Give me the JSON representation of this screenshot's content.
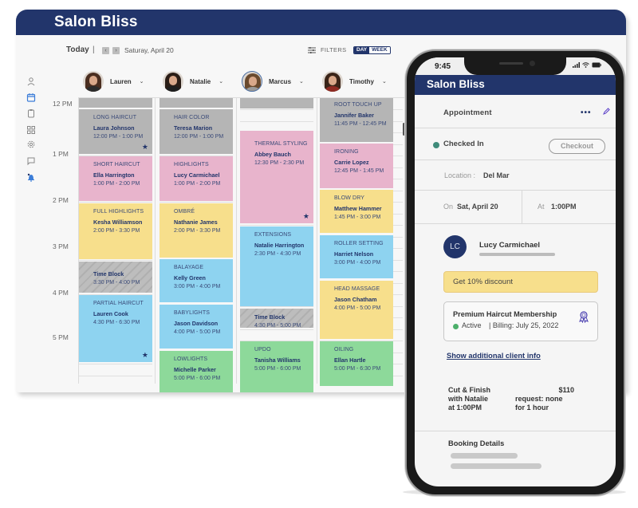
{
  "app": {
    "title": "Salon Bliss"
  },
  "sidebar": {
    "items": [
      {
        "icon": "user-icon",
        "active": false
      },
      {
        "icon": "calendar-icon",
        "active": true
      },
      {
        "icon": "clipboard-icon",
        "active": false
      },
      {
        "icon": "grid-icon",
        "active": false
      },
      {
        "icon": "gear-icon",
        "active": false
      },
      {
        "icon": "chat-icon",
        "active": false
      },
      {
        "icon": "bell-icon",
        "active": false
      }
    ]
  },
  "toolbar": {
    "today_label": "Today",
    "separator": "|",
    "prev_icon": "‹",
    "next_icon": "›",
    "date": "Saturay, April 20",
    "filters_label": "FILTERS",
    "view_day": "DAY",
    "view_week": "WEEK",
    "active_view": "DAY"
  },
  "staff": [
    {
      "name": "Lauren",
      "chevron": "⌄"
    },
    {
      "name": "Natalie",
      "chevron": "⌄"
    },
    {
      "name": "Marcus",
      "chevron": "⌄"
    },
    {
      "name": "Timothy",
      "chevron": "⌄"
    }
  ],
  "time_labels": [
    "12 PM",
    "1 PM",
    "2 PM",
    "3 PM",
    "4 PM",
    "5 PM"
  ],
  "appointments": {
    "lauren": [
      {
        "service": "LONG HAIRCUT",
        "client": "Laura Johnson",
        "time": "12:00 PM - 1:00 PM",
        "color": "gray",
        "starred": true
      },
      {
        "service": "SHORT HAIRCUT",
        "client": "Ella Harrington",
        "time": "1:00 PM - 2:00 PM",
        "color": "pink",
        "starred": false
      },
      {
        "service": "FULL HIGHLIGHTS",
        "client": "Kesha Williamson",
        "time": "2:00 PM - 3:30 PM",
        "color": "yellow",
        "starred": false
      },
      {
        "service": "",
        "client": "Time Block",
        "time": "3:30 PM - 4:00 PM",
        "color": "block",
        "starred": false
      },
      {
        "service": "PARTIAL HAIRCUT",
        "client": "Lauren Cook",
        "time": "4:30 PM - 6:30 PM",
        "color": "blue",
        "starred": true
      }
    ],
    "natalie": [
      {
        "service": "HAIR COLOR",
        "client": "Teresa Marion",
        "time": "12:00 PM - 1:00 PM",
        "color": "gray",
        "starred": false
      },
      {
        "service": "HIGHLIGHTS",
        "client": "Lucy Carmichael",
        "time": "1:00 PM - 2:00 PM",
        "color": "pink",
        "starred": false
      },
      {
        "service": "OMBRÉ",
        "client": "Nathanie James",
        "time": "2:00 PM - 3:30 PM",
        "color": "yellow",
        "starred": false
      },
      {
        "service": "BALAYAGE",
        "client": "Kelly Green",
        "time": "3:00 PM - 4:00 PM",
        "color": "blue",
        "starred": false
      },
      {
        "service": "BABYLIGHTS",
        "client": "Jason Davidson",
        "time": "4:00 PM - 5:00 PM",
        "color": "blue",
        "starred": false
      },
      {
        "service": "LOWLIGHTS",
        "client": "Michelle Parker",
        "time": "5:00 PM - 6:00 PM",
        "color": "green",
        "starred": false
      }
    ],
    "marcus": [
      {
        "service": "THERMAL STYLING",
        "client": "Abbey Bauch",
        "time": "12:30 PM - 2:30 PM",
        "color": "pink",
        "starred": true
      },
      {
        "service": "EXTENSIONS",
        "client": "Natalie Harrington",
        "time": "2:30 PM - 4:30 PM",
        "color": "blue",
        "starred": false
      },
      {
        "service": "",
        "client": "Time Block",
        "time": "4:30 PM - 5:00 PM",
        "color": "block",
        "starred": false
      },
      {
        "service": "UPDO",
        "client": "Tanisha Williams",
        "time": "5:00 PM - 6:00 PM",
        "color": "green",
        "starred": false
      }
    ],
    "timothy": [
      {
        "service": "ROOT TOUCH UP",
        "client": "Jannifer Baker",
        "time": "11:45 PM - 12:45 PM",
        "color": "gray",
        "starred": false
      },
      {
        "service": "IRONING",
        "client": "Carrie Lopez",
        "time": "12:45 PM - 1:45 PM",
        "color": "pink",
        "starred": false
      },
      {
        "service": "BLOW DRY",
        "client": "Matthew Hammer",
        "time": "1:45 PM - 3:00 PM",
        "color": "yellow",
        "starred": false
      },
      {
        "service": "ROLLER SETTING",
        "client": "Harriet Nelson",
        "time": "3:00 PM - 4:00 PM",
        "color": "blue",
        "starred": false
      },
      {
        "service": "HEAD MASSAGE",
        "client": "Jason Chatham",
        "time": "4:00 PM - 5:00 PM",
        "color": "yellow",
        "starred": false
      },
      {
        "service": "OILING",
        "client": "Ellan Hartle",
        "time": "5:00 PM - 6:30 PM",
        "color": "green",
        "starred": false
      }
    ]
  },
  "colors": {
    "brand": "#22356b",
    "gray": "#b5b5b5",
    "pink": "#e8b4cc",
    "yellow": "#f7df8c",
    "blue": "#8ed3f0",
    "green": "#8dd99a",
    "checked_in": "#3f8b7a",
    "active": "#4caf6a"
  },
  "mobile": {
    "status_time": "9:45",
    "title": "Salon Bliss",
    "appointment_label": "Appointment",
    "more_icon": "•••",
    "status": "Checked In",
    "checkout_label": "Checkout",
    "location_label": "Location :",
    "location_value": "Del Mar",
    "on_label": "On",
    "on_value": "Sat, April 20",
    "at_label": "At",
    "at_value": "1:00PM",
    "client_initials": "LC",
    "client_name": "Lucy Carmichael",
    "discount": "Get 10% discount",
    "membership_title": "Premium Haircut Membership",
    "membership_status": "Active",
    "membership_billing": "| Billing: July 25, 2022",
    "additional_info_link": "Show additional client info",
    "service_lines": [
      "Cut & Finish",
      "with Natalie",
      "at 1:00PM"
    ],
    "price": "$110",
    "request": "request: none",
    "duration": "for 1 hour",
    "booking_details": "Booking Details"
  }
}
